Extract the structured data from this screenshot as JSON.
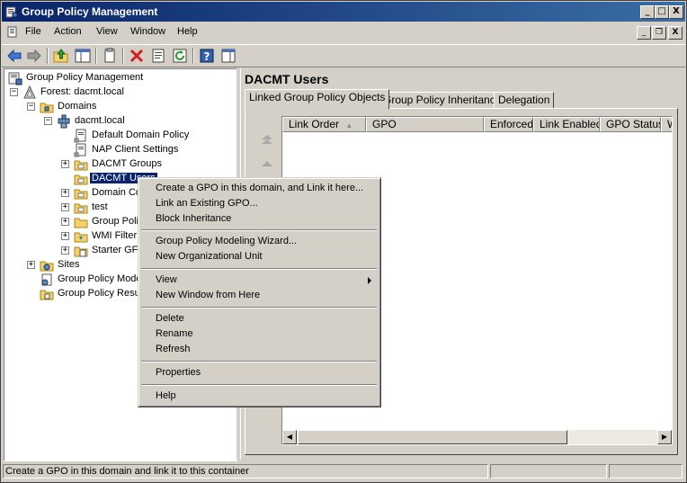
{
  "window": {
    "title": "Group Policy Management",
    "caption_minimize": "_",
    "caption_maximize": "□",
    "caption_close": "X"
  },
  "menubar": {
    "items": [
      "File",
      "Action",
      "View",
      "Window",
      "Help"
    ],
    "mdi_minimize": "_",
    "mdi_restore": "❐",
    "mdi_close": "X"
  },
  "toolbar": {
    "buttons": [
      "back-icon",
      "forward-icon",
      "up-folder-icon",
      "show-hide-tree-icon",
      "copy-icon",
      "delete-icon",
      "properties-icon",
      "refresh-icon",
      "help-icon",
      "action-pane-icon"
    ]
  },
  "tree": {
    "nodes": [
      {
        "label": "Group Policy Management",
        "icon": "gpm-console-icon"
      },
      {
        "label": "Forest: dacmt.local",
        "icon": "forest-icon",
        "expander": "−"
      },
      {
        "label": "Domains",
        "icon": "domains-folder-icon",
        "expander": "−"
      },
      {
        "label": "dacmt.local",
        "icon": "domain-icon",
        "expander": "−"
      },
      {
        "label": "Default Domain Policy",
        "icon": "gpo-link-icon"
      },
      {
        "label": "NAP Client Settings",
        "icon": "gpo-link-icon"
      },
      {
        "label": "DACMT Groups",
        "icon": "ou-folder-icon",
        "expander": "+"
      },
      {
        "label": "DACMT Users",
        "icon": "ou-folder-icon",
        "selected": true
      },
      {
        "label": "Domain Co",
        "icon": "ou-folder-icon",
        "expander": "+"
      },
      {
        "label": "test",
        "icon": "ou-folder-icon",
        "expander": "+"
      },
      {
        "label": "Group Poli",
        "icon": "gpo-folder-icon",
        "expander": "+"
      },
      {
        "label": "WMI Filter",
        "icon": "wmi-folder-icon",
        "expander": "+"
      },
      {
        "label": "Starter GF",
        "icon": "starter-gpo-folder-icon",
        "expander": "+"
      },
      {
        "label": "Sites",
        "icon": "sites-folder-icon",
        "expander": "+"
      },
      {
        "label": "Group Policy Mode",
        "icon": "modeling-icon"
      },
      {
        "label": "Group Policy Resu",
        "icon": "results-icon"
      }
    ]
  },
  "right_pane": {
    "title": "DACMT Users",
    "tabs": [
      "Linked Group Policy Objects",
      "Group Policy Inheritance",
      "Delegation"
    ],
    "active_tab": 0,
    "columns": [
      "Link Order",
      "GPO",
      "Enforced",
      "Link Enabled",
      "GPO Status",
      "W"
    ],
    "sort_indicator": "▲"
  },
  "context_menu": {
    "items": [
      {
        "label": "Create a GPO in this domain, and Link it here..."
      },
      {
        "label": "Link an Existing GPO..."
      },
      {
        "label": "Block Inheritance"
      },
      {
        "sep": true
      },
      {
        "label": "Group Policy Modeling Wizard..."
      },
      {
        "label": "New Organizational Unit"
      },
      {
        "sep": true
      },
      {
        "label": "View",
        "submenu": true
      },
      {
        "label": "New Window from Here"
      },
      {
        "sep": true
      },
      {
        "label": "Delete"
      },
      {
        "label": "Rename"
      },
      {
        "label": "Refresh"
      },
      {
        "sep": true
      },
      {
        "label": "Properties"
      },
      {
        "sep": true
      },
      {
        "label": "Help"
      }
    ]
  },
  "statusbar": {
    "text": "Create a GPO in this domain and link it to this container"
  },
  "colors": {
    "title_gradient_start": "#0a246a",
    "title_gradient_end": "#3a6ea5",
    "selection": "#0a246a",
    "face": "#d4d0c8"
  }
}
